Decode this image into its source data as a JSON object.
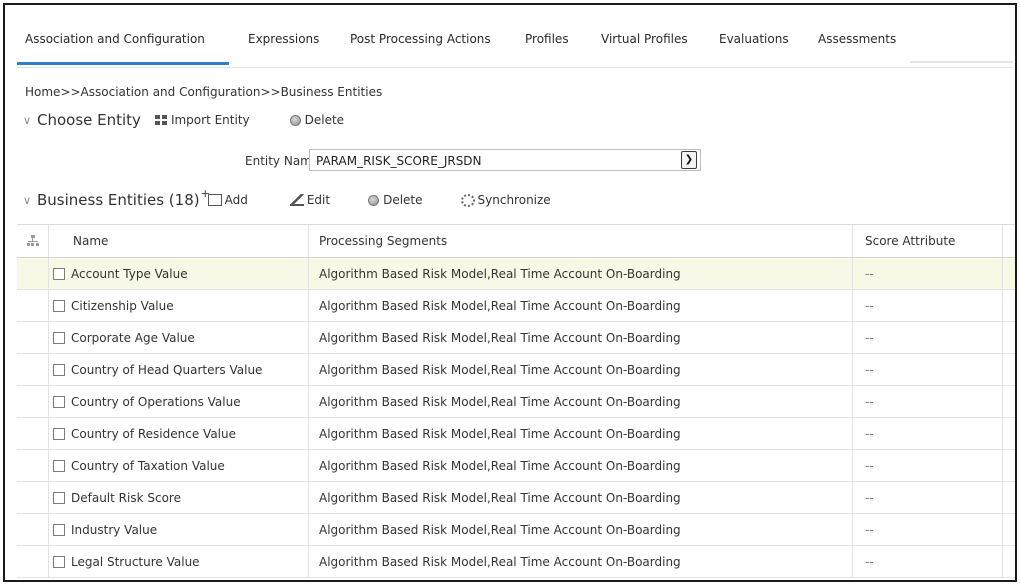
{
  "tabs": [
    {
      "label": "Association and Configuration",
      "active": true
    },
    {
      "label": "Expressions"
    },
    {
      "label": "Post Processing Actions"
    },
    {
      "label": "Profiles"
    },
    {
      "label": "Virtual Profiles"
    },
    {
      "label": "Evaluations"
    },
    {
      "label": "Assessments"
    }
  ],
  "breadcrumb": "Home>>Association and Configuration>>Business Entities",
  "choose_entity": {
    "title": "Choose Entity",
    "import_label": "Import Entity",
    "delete_label": "Delete"
  },
  "entity_name": {
    "label": "Entity Name",
    "required_mark": "*",
    "value": "PARAM_RISK_SCORE_JRSDN"
  },
  "business_entities": {
    "title": "Business Entities (18)",
    "add_label": "Add",
    "edit_label": "Edit",
    "delete_label": "Delete",
    "sync_label": "Synchronize"
  },
  "table": {
    "headers": {
      "name": "Name",
      "segments": "Processing Segments",
      "score": "Score Attribute"
    },
    "rows": [
      {
        "name": "Account Type Value",
        "segments": "Algorithm Based Risk Model,Real Time Account On-Boarding",
        "score": "--"
      },
      {
        "name": "Citizenship Value",
        "segments": "Algorithm Based Risk Model,Real Time Account On-Boarding",
        "score": "--"
      },
      {
        "name": "Corporate Age Value",
        "segments": "Algorithm Based Risk Model,Real Time Account On-Boarding",
        "score": "--"
      },
      {
        "name": "Country of Head Quarters Value",
        "segments": "Algorithm Based Risk Model,Real Time Account On-Boarding",
        "score": "--"
      },
      {
        "name": "Country of Operations Value",
        "segments": "Algorithm Based Risk Model,Real Time Account On-Boarding",
        "score": "--"
      },
      {
        "name": "Country of Residence Value",
        "segments": "Algorithm Based Risk Model,Real Time Account On-Boarding",
        "score": "--"
      },
      {
        "name": "Country of Taxation Value",
        "segments": "Algorithm Based Risk Model,Real Time Account On-Boarding",
        "score": "--"
      },
      {
        "name": "Default Risk Score",
        "segments": "Algorithm Based Risk Model,Real Time Account On-Boarding",
        "score": "--"
      },
      {
        "name": "Industry Value",
        "segments": "Algorithm Based Risk Model,Real Time Account On-Boarding",
        "score": "--"
      },
      {
        "name": "Legal Structure Value",
        "segments": "Algorithm Based Risk Model,Real Time Account On-Boarding",
        "score": "--"
      }
    ]
  },
  "colors": {
    "accent": "#2f7fd1",
    "row_highlight": "#f7f9e6"
  }
}
